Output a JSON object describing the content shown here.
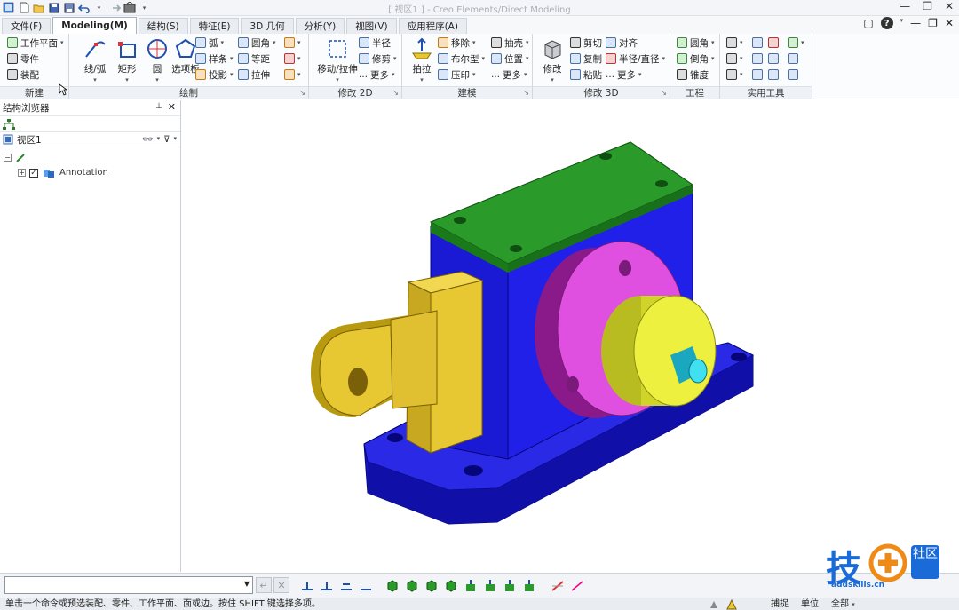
{
  "window": {
    "title": "[ 视区1 ] - Creo Elements/Direct Modeling"
  },
  "tabs": [
    {
      "label": "文件(F)"
    },
    {
      "label": "Modeling(M)"
    },
    {
      "label": "结构(S)"
    },
    {
      "label": "特征(E)"
    },
    {
      "label": "3D 几何"
    },
    {
      "label": "分析(Y)"
    },
    {
      "label": "视图(V)"
    },
    {
      "label": "应用程序(A)"
    }
  ],
  "ribbon": {
    "new_group": {
      "title": "新建",
      "items": [
        "工作平面",
        "零件",
        "装配"
      ]
    },
    "draw_group": {
      "title": "绘制",
      "big": [
        "线/弧",
        "矩形",
        "圆",
        "选项板"
      ],
      "small": [
        "弧",
        "样条",
        "投影",
        "圆角",
        "等距",
        "拉伸"
      ]
    },
    "modify2d_group": {
      "title": "修改 2D",
      "big": [
        "移动/拉伸"
      ],
      "small": [
        "半径",
        "修剪",
        "更多"
      ]
    },
    "model_group": {
      "title": "建模",
      "big": [
        "拍拉"
      ],
      "small": [
        "移除",
        "布尔型",
        "压印",
        "抽壳",
        "位置",
        "更多"
      ]
    },
    "modify3d_group": {
      "title": "修改 3D",
      "big": [
        "修改"
      ],
      "small": [
        "剪切",
        "复制",
        "粘贴",
        "对齐",
        "半径/直径",
        "更多"
      ]
    },
    "eng_group": {
      "title": "工程",
      "small": [
        "圆角",
        "倒角",
        "锥度"
      ]
    },
    "util_group": {
      "title": "实用工具"
    }
  },
  "browser": {
    "title": "结构浏览器",
    "root": "视区1",
    "tree": [
      {
        "label": "Annotation",
        "checked": true
      }
    ]
  },
  "status": {
    "message": "单击一个命令或预选装配、零件、工作平面、面或边。按住 SHIFT 键选择多项。",
    "capture": "捕捉",
    "unit": "单位",
    "filter": "全部"
  },
  "watermark": {
    "main": "技",
    "sub": "社区",
    "site": "addskills.cn"
  },
  "colors": {
    "base": "#1a1ad8",
    "top_plate": "#1f8a1f",
    "flange": "#d04ad0",
    "hub": "#e8ec3a",
    "arm": "#e8c832",
    "shaft": "#2ad0e0"
  }
}
